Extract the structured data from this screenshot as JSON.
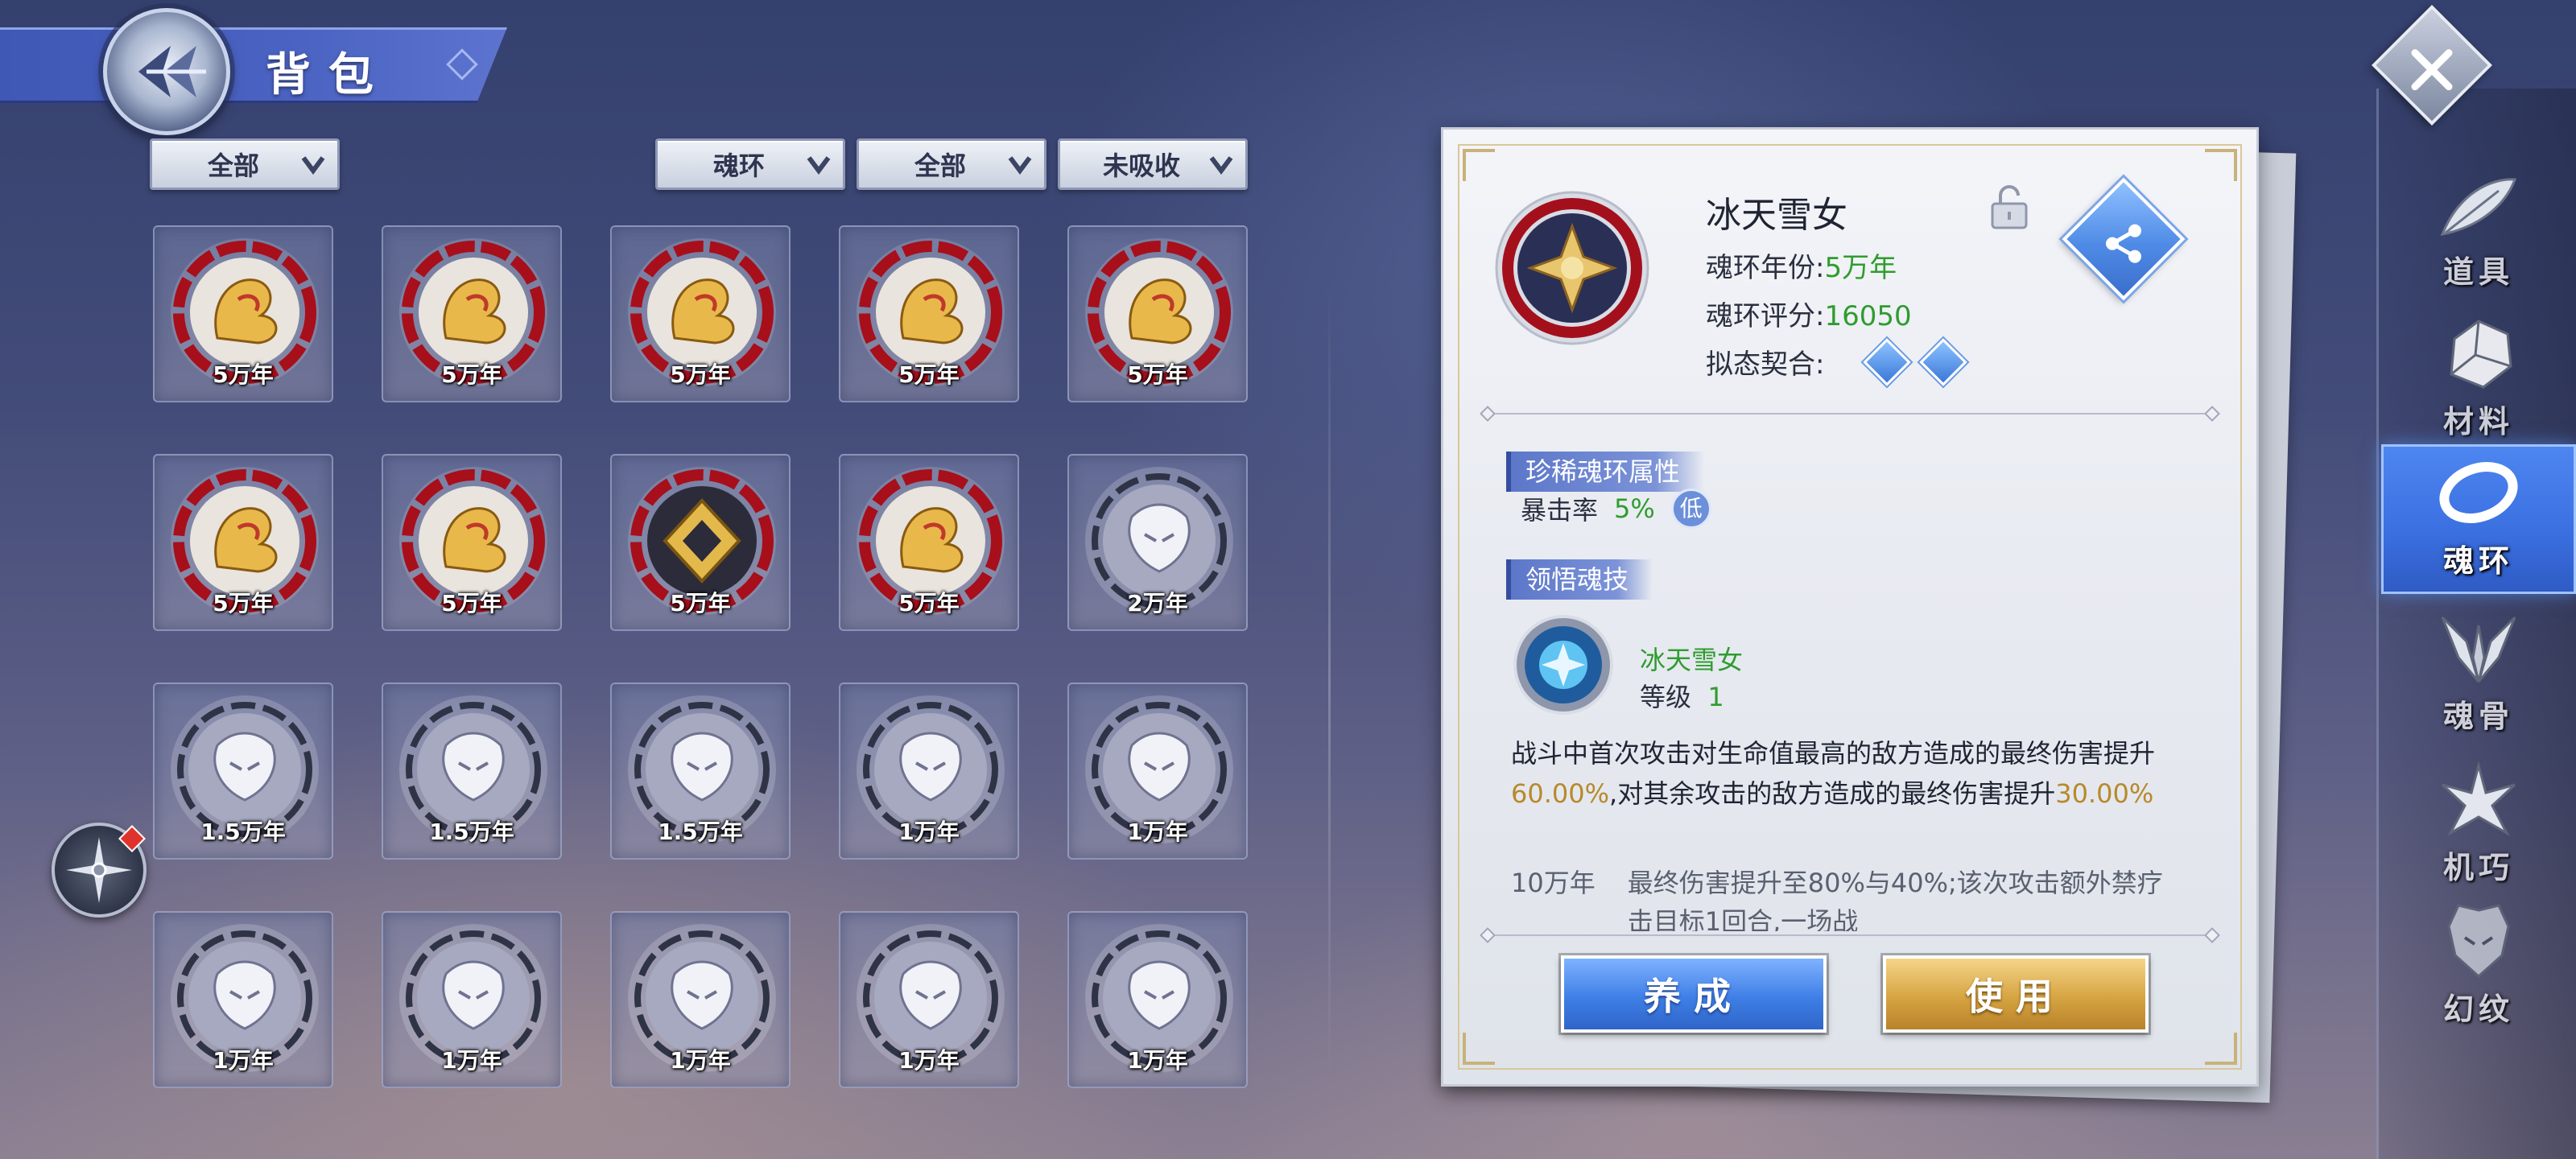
{
  "header": {
    "title": "背包"
  },
  "filters": {
    "category": "全部",
    "type": "魂环",
    "range": "全部",
    "status": "未吸收"
  },
  "grid": {
    "items": [
      {
        "years": "5万年",
        "style": "red"
      },
      {
        "years": "5万年",
        "style": "red"
      },
      {
        "years": "5万年",
        "style": "red"
      },
      {
        "years": "5万年",
        "style": "red"
      },
      {
        "years": "5万年",
        "style": "red"
      },
      {
        "years": "5万年",
        "style": "red"
      },
      {
        "years": "5万年",
        "style": "red"
      },
      {
        "years": "5万年",
        "style": "red-dark"
      },
      {
        "years": "5万年",
        "style": "red"
      },
      {
        "years": "2万年",
        "style": "silver"
      },
      {
        "years": "1.5万年",
        "style": "silver"
      },
      {
        "years": "1.5万年",
        "style": "silver"
      },
      {
        "years": "1.5万年",
        "style": "silver"
      },
      {
        "years": "1万年",
        "style": "silver"
      },
      {
        "years": "1万年",
        "style": "silver"
      },
      {
        "years": "1万年",
        "style": "silver"
      },
      {
        "years": "1万年",
        "style": "silver"
      },
      {
        "years": "1万年",
        "style": "silver"
      },
      {
        "years": "1万年",
        "style": "silver"
      },
      {
        "years": "1万年",
        "style": "silver"
      }
    ]
  },
  "detail": {
    "name": "冰天雪女",
    "year_label": "魂环年份:",
    "year_value": "5万年",
    "score_label": "魂环评分:",
    "score_value": "16050",
    "fit_label": "拟态契合:",
    "rare_attr_title": "珍稀魂环属性",
    "attr_name": "暴击率",
    "attr_value": "5%",
    "attr_grade": "低",
    "skill_section_title": "领悟魂技",
    "skill_name": "冰天雪女",
    "skill_level_label": "等级",
    "skill_level_value": "1",
    "desc_part1": "战斗中首次攻击对生命值最高的敌方造成的最终伤害提升",
    "desc_val1": "60.00%",
    "desc_part2": ",对其余攻击的敌方造成的最终伤害提升",
    "desc_val2": "30.00%",
    "upgrade_tier": "10万年",
    "upgrade_text": "最终伤害提升至80%与40%;该次攻击额外禁疗击目标1回合,一场战",
    "cultivate_label": "养成",
    "use_label": "使用"
  },
  "sidebar": {
    "tabs": [
      {
        "label": "道具"
      },
      {
        "label": "材料"
      },
      {
        "label": "魂环"
      },
      {
        "label": "魂骨"
      },
      {
        "label": "机巧"
      },
      {
        "label": "幻纹"
      }
    ],
    "active": "魂环"
  },
  "colors": {
    "accent_blue": "#3a6fe0",
    "value_green": "#2f9c2e",
    "value_gold": "#b8892b",
    "ring_red": "#b3121f"
  }
}
